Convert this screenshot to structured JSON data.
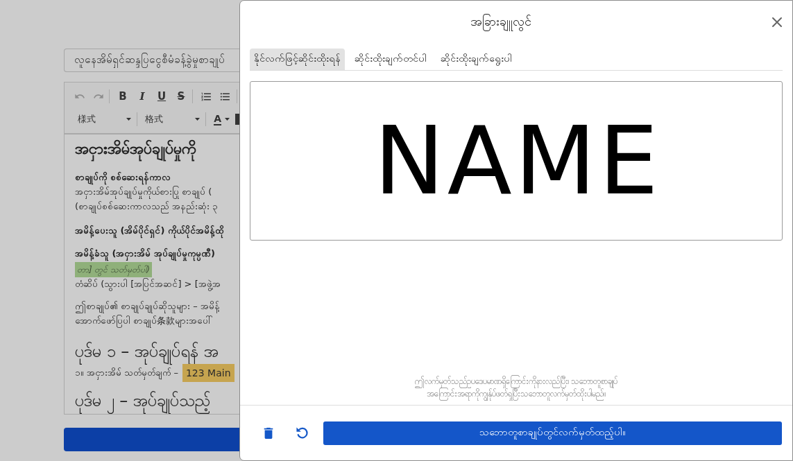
{
  "document_editor": {
    "title_field": {
      "value": "လူနေအိမ်ရှင်ဆန္ဒပြငွေစီမံခန့်ခွဲမှုစာချုပ်"
    },
    "toolbar": {
      "undo": {
        "disabled": true
      },
      "redo": {
        "disabled": true
      },
      "format_buttons": [
        {
          "kind": "bold",
          "label": "B"
        },
        {
          "kind": "italic",
          "label": "I"
        },
        {
          "kind": "underline",
          "label": "U"
        },
        {
          "kind": "strike",
          "label": "S"
        }
      ],
      "dropdowns": [
        {
          "label": "様式"
        },
        {
          "label": "格式"
        }
      ],
      "font_color": {
        "label": "A"
      }
    },
    "content": [
      {
        "kind": "heading",
        "text": "အငှားအိမ်အုပ်ချုပ်မှုကို"
      },
      {
        "kind": "subheading",
        "text": "စာချုပ်ကို စစ်ဆေးရန်ကာလ"
      },
      {
        "kind": "paragraph",
        "lines": [
          "အငှားအိမ်အုပ်ချုပ်မှုကိုယ်စားပြု စာချုပ် (",
          "(စာချုပ်စစ်ဆေးကာလသည် အနည်းဆုံး ၃"
        ]
      },
      {
        "kind": "subheading",
        "text": "အမိန့်ပေးသူ (အိမ်ပိုင်ရှင်) ကိုယ်ပိုင်အမိန့်ထို"
      },
      {
        "kind": "subheading",
        "text": "အမိန့်ခံသူ (အငှားအိမ် အုပ်ချုပ်မှုကုမ္ပဏီ)"
      },
      {
        "kind": "note",
        "text": "တာ] တွင် သတ်မှတ်ပါ)"
      },
      {
        "kind": "line",
        "text": "တံဆိပ် (သွားပါ [အပြင်အဆင်] > [အဖွဲ့အ"
      },
      {
        "kind": "paragraph",
        "lines": [
          "ဤစာချုပ်၏ စာချုပ်ချုပ်ဆိုသူများ – အမိန့်",
          "အောက်ဖော်ပြပါ စာချုပ်条款များအပေါ်"
        ]
      },
      {
        "kind": "section",
        "text": "ပုဒ်မ ၁ – အုပ်ချုပ်ရန် အ"
      },
      {
        "kind": "list_item",
        "text": "၁။ အငှားအိမ် သတ်မှတ်ချက် –",
        "highlight": "123 Main"
      },
      {
        "kind": "section",
        "text": "ပုဒ်မ ၂ – အုပ်ချုပ်သည့်"
      }
    ]
  },
  "signature_dialog": {
    "title": "အခြားချူလွင်",
    "tabs": [
      {
        "label": "နိုင်လက်ဖြင့်ဆိုင်းထိုးရန်",
        "selected": true
      },
      {
        "label": "ဆိုင်းထိုးချက်တင်ပါ",
        "selected": false
      },
      {
        "label": "ဆိုင်းထိုးချက်ရွေးပါ",
        "selected": false
      }
    ],
    "signature_pad": {
      "signature": "NAME"
    },
    "disclaimer": "ဤလက်မှတ်သည်ဥပဒေပမာဏရှိကြောင်းကိုနားလည်ပြီး၊ သဘောတူစာချုပ်\nအကြောင်းအရာကိုကျွန်ုပ်ဖတ်ရှုပြီးသဘောတူလက်မှတ်ထိုးပါမည်။",
    "footer": {
      "confirm_button": "သဘောတူစာချုပ်တွင်လက်မှတ်ထည့်ပါ။"
    }
  }
}
